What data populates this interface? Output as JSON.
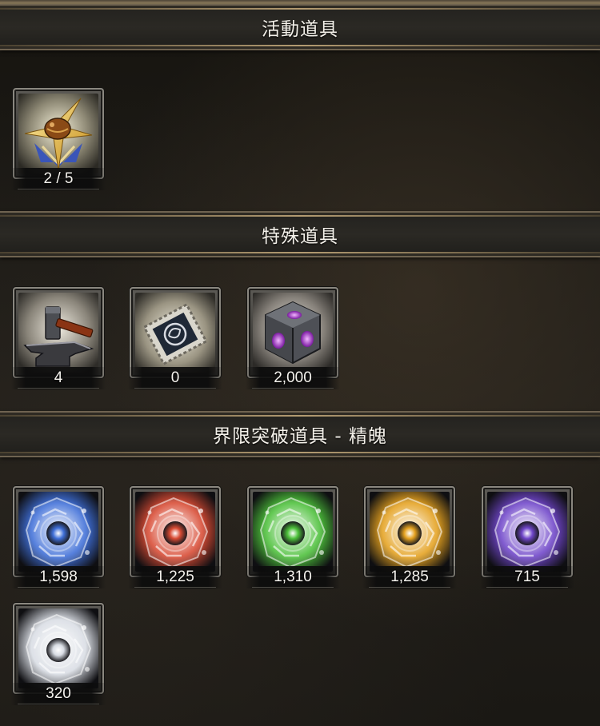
{
  "sections": [
    {
      "title": "活動道具",
      "items": [
        {
          "icon": "compass-star-emblem-icon",
          "count": "2 / 5"
        }
      ]
    },
    {
      "title": "特殊道具",
      "items": [
        {
          "icon": "hammer-anvil-icon",
          "count": "4"
        },
        {
          "icon": "stamp-ticket-icon",
          "count": "0"
        },
        {
          "icon": "purple-gem-cube-icon",
          "count": "2,000"
        }
      ]
    },
    {
      "title": "界限突破道具 - 精魄",
      "items": [
        {
          "icon": "blue-essence-crystal-icon",
          "count": "1,598",
          "color": "#3f6fd8"
        },
        {
          "icon": "red-essence-crystal-icon",
          "count": "1,225",
          "color": "#d84a33"
        },
        {
          "icon": "green-essence-crystal-icon",
          "count": "1,310",
          "color": "#4cc03a"
        },
        {
          "icon": "gold-essence-crystal-icon",
          "count": "1,285",
          "color": "#e4a11f"
        },
        {
          "icon": "purple-essence-crystal-icon",
          "count": "715",
          "color": "#6f45c9"
        },
        {
          "icon": "white-essence-crystal-icon",
          "count": "320",
          "color": "#d9dde4"
        }
      ]
    }
  ]
}
